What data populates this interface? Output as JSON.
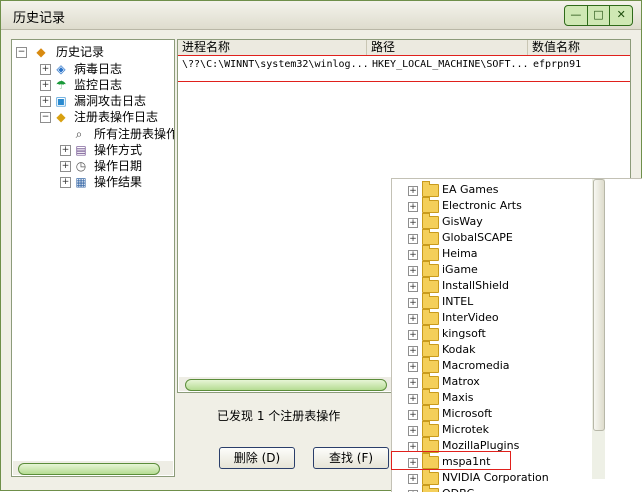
{
  "window": {
    "title": "历史记录",
    "controls": [
      "—",
      "□",
      "✕"
    ]
  },
  "tree": {
    "root": "历史记录",
    "items": [
      {
        "label": "病毒日志",
        "icon": "virus-log-icon"
      },
      {
        "label": "监控日志",
        "icon": "monitor-log-icon"
      },
      {
        "label": "漏洞攻击日志",
        "icon": "vulnerability-log-icon"
      },
      {
        "label": "注册表操作日志",
        "icon": "registry-log-icon"
      }
    ],
    "registry_children": [
      {
        "label": "所有注册表操作",
        "icon": "search-icon"
      },
      {
        "label": "操作方式",
        "icon": "operation-icon"
      },
      {
        "label": "操作日期",
        "icon": "calendar-icon"
      },
      {
        "label": "操作结果",
        "icon": "result-icon"
      }
    ]
  },
  "list": {
    "columns": [
      "进程名称",
      "路径",
      "数值名称"
    ],
    "rows": [
      {
        "process": "\\??\\C:\\WINNT\\system32\\winlog...",
        "path": "HKEY_LOCAL_MACHINE\\SOFT...",
        "value": "efprpn91"
      }
    ]
  },
  "status": "已发现  1  个注册表操作",
  "buttons": {
    "delete": "删除 (D)",
    "find": "查找 (F)"
  },
  "folders": [
    "EA Games",
    "Electronic Arts",
    "GisWay",
    "GlobalSCAPE",
    "Heima",
    "iGame",
    "InstallShield",
    "INTEL",
    "InterVideo",
    "kingsoft",
    "Kodak",
    "Macromedia",
    "Matrox",
    "Maxis",
    "Microsoft",
    "Microtek",
    "MozillaPlugins",
    "mspa1nt",
    "NVIDIA Corporation",
    "ODBC"
  ]
}
